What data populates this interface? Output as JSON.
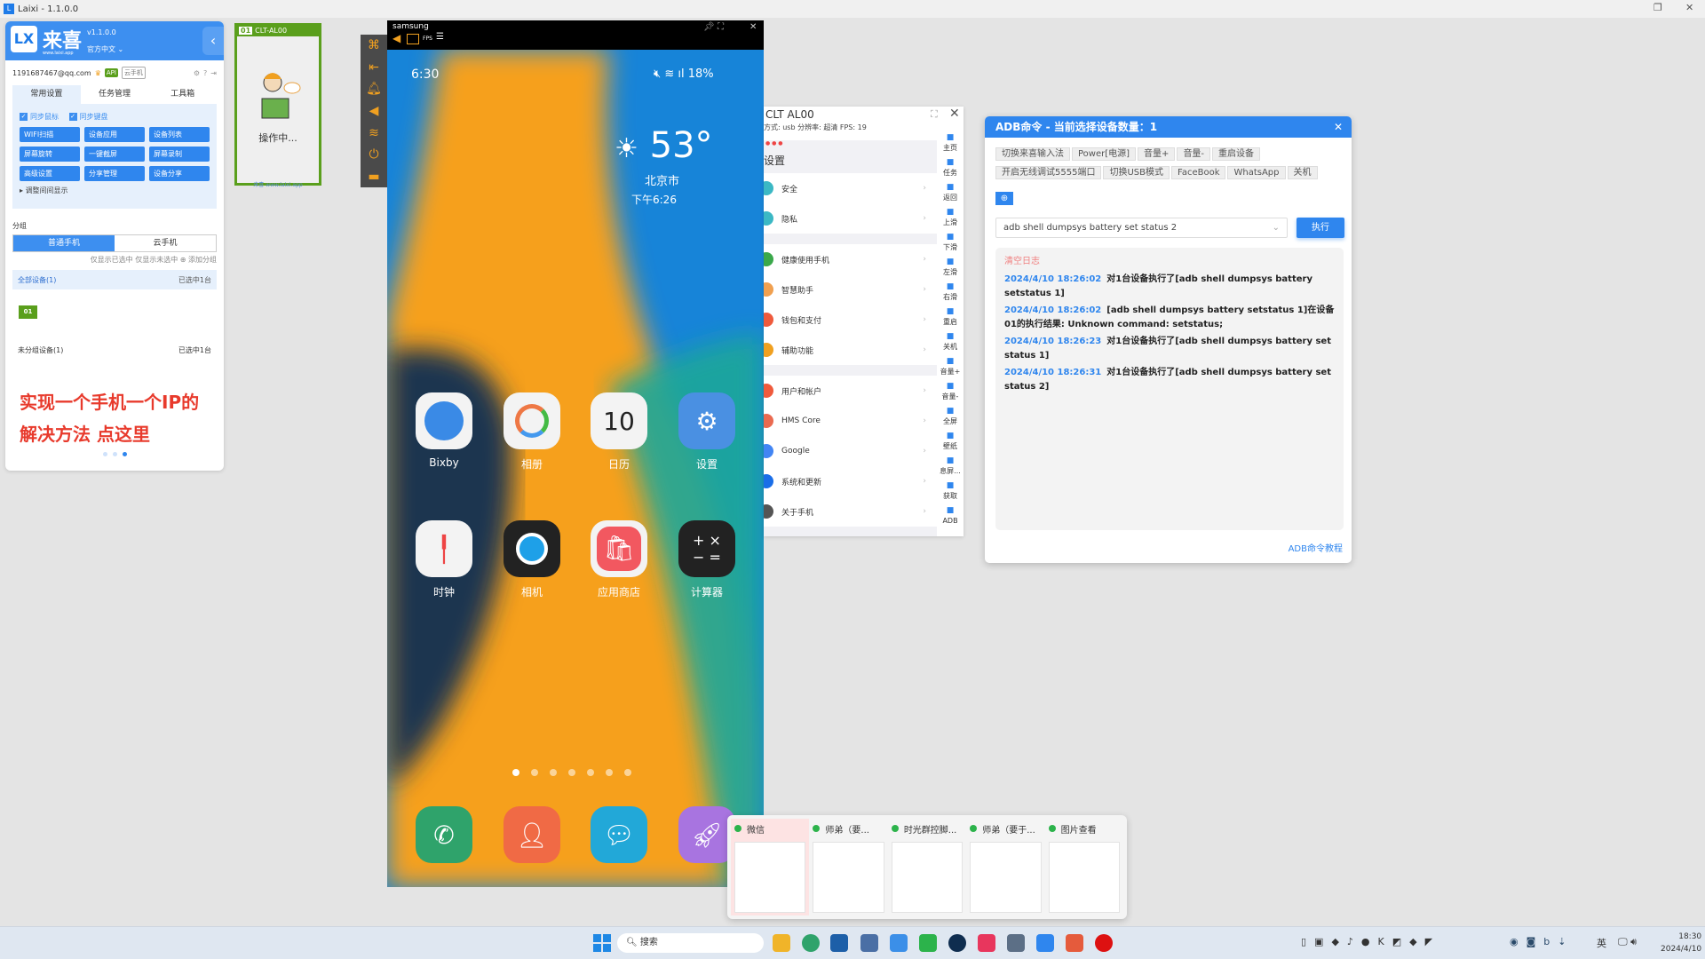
{
  "window": {
    "title": "Laixi - 1.1.0.0"
  },
  "left_panel": {
    "brand": "来喜",
    "brand_url": "www.laixi.app",
    "version": "v1.1.0.0",
    "language": "官方中文",
    "account": "1191687467@qq.com",
    "badges": [
      "API",
      "云手机"
    ],
    "tabs": [
      {
        "label": "常用设置",
        "active": true
      },
      {
        "label": "任务管理"
      },
      {
        "label": "工具箱"
      }
    ],
    "checks": [
      "同步鼠标",
      "同步键盘"
    ],
    "buttons": [
      "WIFI扫描",
      "设备应用",
      "设备列表",
      "屏幕旋转",
      "一键截屏",
      "屏幕录制",
      "高级设置",
      "分享管理",
      "设备分享"
    ],
    "adjust_label": "调整间间显示",
    "group_label": "分组",
    "segments": [
      {
        "label": "普通手机",
        "active": true
      },
      {
        "label": "云手机"
      }
    ],
    "seg_hint": "仅显示已选中  仅显示未选中  ⊕ 添加分组",
    "all_devices": "全部设备(1)",
    "all_selected": "已选中1台",
    "device_tag": "01",
    "group_devices": "未分组设备(1)",
    "group_selected": "已选中1台",
    "promo_line1": "实现一个手机一个IP的",
    "promo_line2": "解决方法  点这里"
  },
  "thumb_card": {
    "tag": "01",
    "name": "CLT-AL00",
    "status": "操作中...",
    "footer": "来喜  www.laixi.app"
  },
  "phone": {
    "window_title": "samsung",
    "fps_label": "FPS",
    "status_time": "6:30",
    "battery": "18%",
    "weather": {
      "temp": "53°",
      "city": "北京市",
      "updated": "下午6:26"
    },
    "apps": [
      "Bixby",
      "相册",
      "日历",
      "设置",
      "时钟",
      "相机",
      "应用商店",
      "计算器"
    ],
    "calendar_day": "10",
    "page_dots": 7,
    "active_dot": 0
  },
  "clt_window": {
    "title": "CLT AL00",
    "info": "方式: usb  分辨率: 超清  FPS: 19",
    "page_title": "设置",
    "settings": [
      "安全",
      "隐私",
      "健康使用手机",
      "智慧助手",
      "钱包和支付",
      "辅助功能",
      "用户和帐户",
      "HMS Core",
      "Google",
      "系统和更新",
      "关于手机"
    ],
    "side_actions": [
      "主页",
      "任务",
      "返回",
      "上滑",
      "下滑",
      "左滑",
      "右滑",
      "重启",
      "关机",
      "音量+",
      "音量-",
      "全屏",
      "壁纸",
      "息屏...",
      "获取",
      "ADB"
    ]
  },
  "adb": {
    "title": "ADB命令 - 当前选择设备数量：1",
    "quick_buttons": [
      "切换来喜输入法",
      "Power[电源]",
      "音量+",
      "音量-",
      "重启设备",
      "开启无线调试5555端口",
      "切换USB模式",
      "FaceBook",
      "WhatsApp",
      "关机"
    ],
    "command": "adb shell dumpsys battery set status 2",
    "execute": "执行",
    "clear_log": "清空日志",
    "log": [
      {
        "time": "2024/4/10 18:26:02",
        "text": "对1台设备执行了[adb shell dumpsys battery setstatus 1]"
      },
      {
        "time": "2024/4/10 18:26:02",
        "text": "[adb shell dumpsys battery setstatus 1]在设备01的执行结果: Unknown command: setstatus;"
      },
      {
        "time": "2024/4/10 18:26:23",
        "text": "对1台设备执行了[adb shell dumpsys battery set status 1]"
      },
      {
        "time": "2024/4/10 18:26:31",
        "text": "对1台设备执行了[adb shell dumpsys battery set status 2]"
      }
    ],
    "tutorial": "ADB命令教程"
  },
  "taskbar_preview": [
    "微信",
    "师弟（要...",
    "时光群控脚...",
    "师弟（要于...",
    "图片查看"
  ],
  "taskbar": {
    "search": "搜索",
    "time": "18:30",
    "date": "2024/4/10",
    "ime": "英"
  },
  "colors": {
    "accent": "#2f86ee",
    "device_green": "#5a9f1c",
    "promo_red": "#e83a2c"
  }
}
